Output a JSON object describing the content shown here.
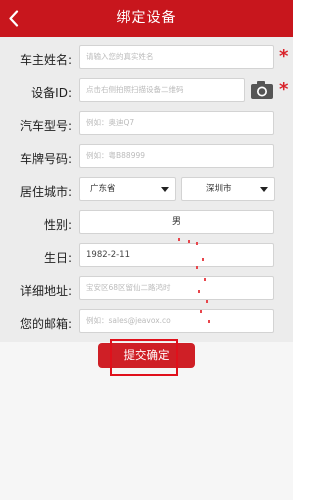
{
  "header": {
    "title": "绑定设备",
    "back_icon": "chevron-left-icon"
  },
  "form": {
    "owner_name": {
      "label": "车主姓名:",
      "placeholder": "请输入您的真实姓名",
      "required": true
    },
    "device_id": {
      "label": "设备ID:",
      "placeholder": "点击右侧拍照扫描设备二维码",
      "required": true,
      "scan_icon": "camera-icon"
    },
    "car_model": {
      "label": "汽车型号:",
      "placeholder": "例如：奥迪Q7"
    },
    "plate_number": {
      "label": "车牌号码:",
      "placeholder": "例如：粤B88999"
    },
    "city": {
      "label": "居住城市:",
      "province": "广东省",
      "city": "深圳市"
    },
    "gender": {
      "label": "性别:",
      "value": "男"
    },
    "birthday": {
      "label": "生日:",
      "value": "1982-2-11"
    },
    "address": {
      "label": "详细地址:",
      "placeholder": "宝安区68区留仙二路鸿时"
    },
    "email": {
      "label": "您的邮箱:",
      "placeholder": "例如：sales@jeavox.co"
    }
  },
  "actions": {
    "submit_label": "提交确定"
  },
  "colors": {
    "brand_red": "#c8161d",
    "required_red": "#d9232b",
    "annotation_red": "#e0101b"
  }
}
